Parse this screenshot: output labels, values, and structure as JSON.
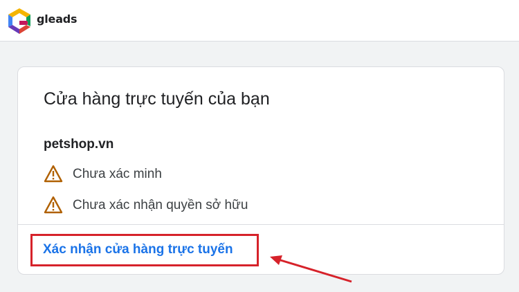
{
  "header": {
    "brand_name": "gleads",
    "logo_icon": "gleads-logo-icon"
  },
  "store_card": {
    "title": "Cửa hàng trực tuyến của bạn",
    "domain": "petshop.vn",
    "statuses": [
      {
        "icon": "warning-icon",
        "label": "Chưa xác minh"
      },
      {
        "icon": "warning-icon",
        "label": "Chưa xác nhận quyền sở hữu"
      }
    ],
    "verify_link_label": "Xác nhận cửa hàng trực tuyến"
  },
  "colors": {
    "link": "#1a73e8",
    "warning": "#b06000",
    "highlight": "#d6222a"
  }
}
